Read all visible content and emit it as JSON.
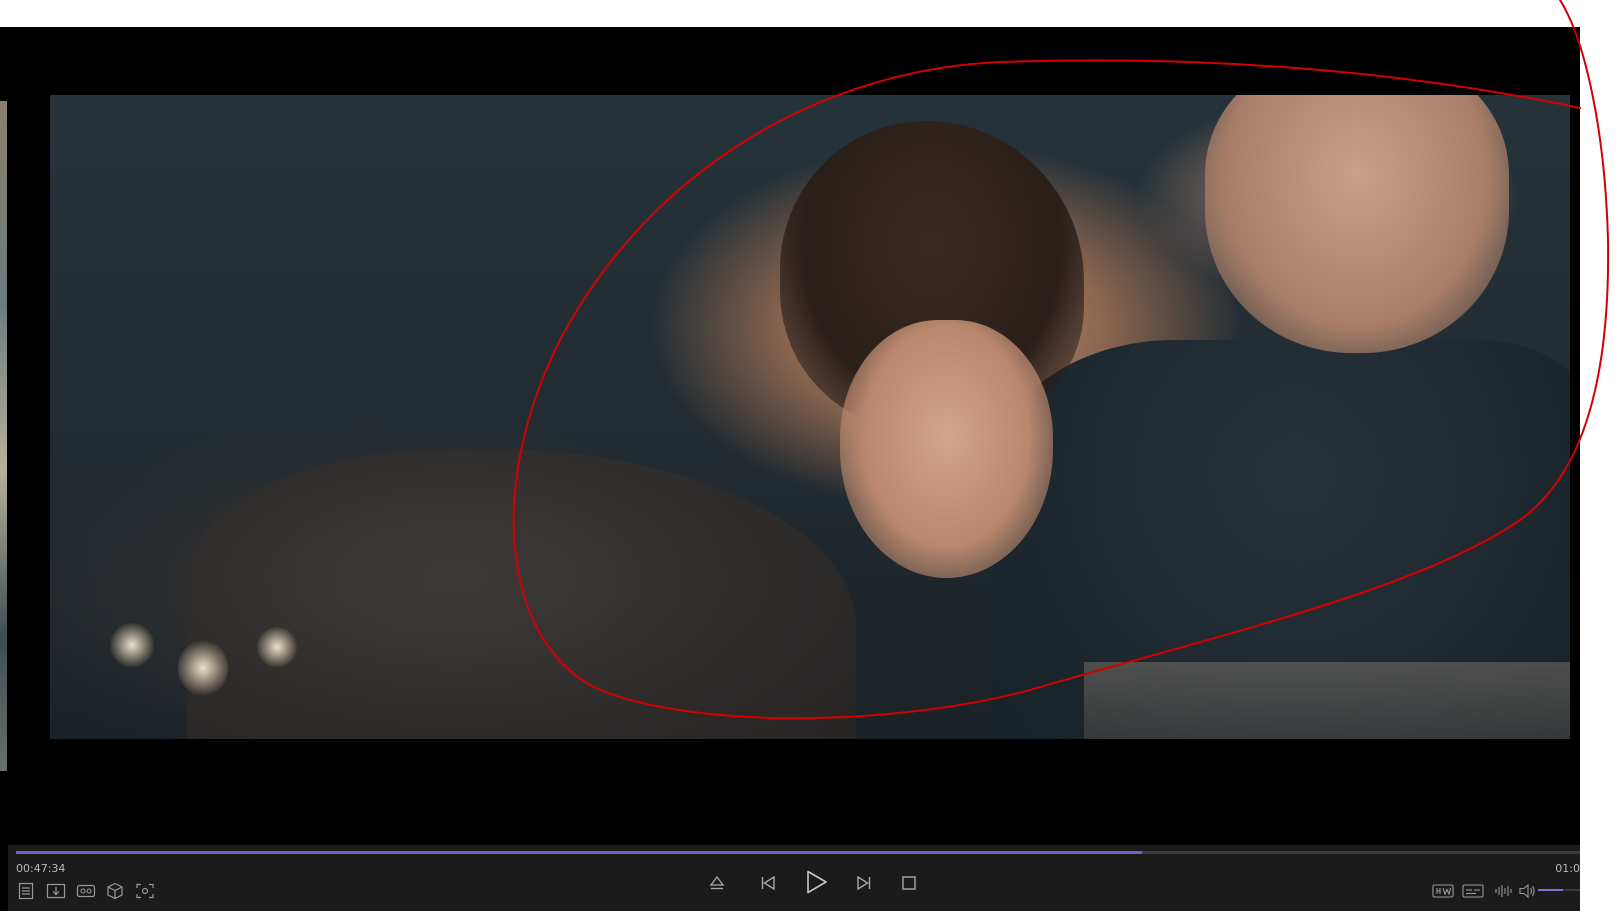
{
  "player": {
    "time_current": "00:47:34",
    "time_total": "01:0",
    "progress_fraction": 0.72,
    "volume_fraction": 0.6,
    "accent_color": "#6f63c7"
  },
  "controls": {
    "left_icons": [
      "playlist-icon",
      "download-icon",
      "vr-icon",
      "3d-cube-icon",
      "screenshot-icon"
    ],
    "center_icons": [
      "eject-icon",
      "previous-icon",
      "play-icon",
      "next-icon",
      "stop-icon"
    ],
    "right_icons": [
      "hw-decode-icon",
      "subtitle-icon",
      "audio-wave-icon",
      "volume-icon"
    ]
  },
  "annotation": {
    "color": "#d40000",
    "shape": "freehand-loop"
  }
}
